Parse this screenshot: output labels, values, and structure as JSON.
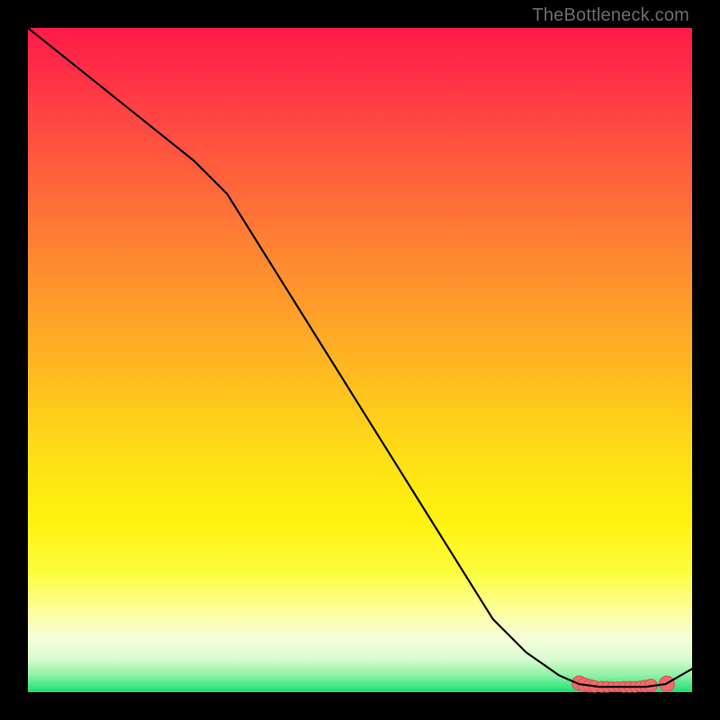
{
  "attribution": "TheBottleneck.com",
  "chart_data": {
    "type": "line",
    "title": "",
    "xlabel": "",
    "ylabel": "",
    "xlim": [
      0,
      100
    ],
    "ylim": [
      0,
      100
    ],
    "series": [
      {
        "name": "curve",
        "x": [
          0,
          5,
          10,
          15,
          20,
          25,
          30,
          35,
          40,
          45,
          50,
          55,
          60,
          65,
          70,
          75,
          80,
          83,
          86,
          90,
          93,
          96,
          100
        ],
        "y": [
          100,
          96,
          92,
          88,
          84,
          80,
          75,
          67,
          59,
          51,
          43,
          35,
          27,
          19,
          11,
          6,
          2.5,
          1.2,
          0.8,
          0.8,
          0.8,
          1.2,
          3.5
        ],
        "stroke": "#000000",
        "stroke_width": 2.2
      }
    ],
    "markers": {
      "name": "bottom-cluster",
      "color": "#ef6a6a",
      "stroke": "#d94f4f",
      "x": [
        83.0,
        83.8,
        84.6,
        85.3,
        86.4,
        87.2,
        88.0,
        88.8,
        89.7,
        90.6,
        91.4,
        92.2,
        93.0,
        93.8,
        96.2
      ],
      "y": [
        1.35,
        1.1,
        0.95,
        0.85,
        0.8,
        0.8,
        0.8,
        0.8,
        0.8,
        0.8,
        0.8,
        0.85,
        0.9,
        1.0,
        1.25
      ],
      "r": [
        8.0,
        7.5,
        7.0,
        6.5,
        6.0,
        6.0,
        5.5,
        5.5,
        6.0,
        6.0,
        6.0,
        6.0,
        6.5,
        7.0,
        8.5
      ]
    }
  }
}
